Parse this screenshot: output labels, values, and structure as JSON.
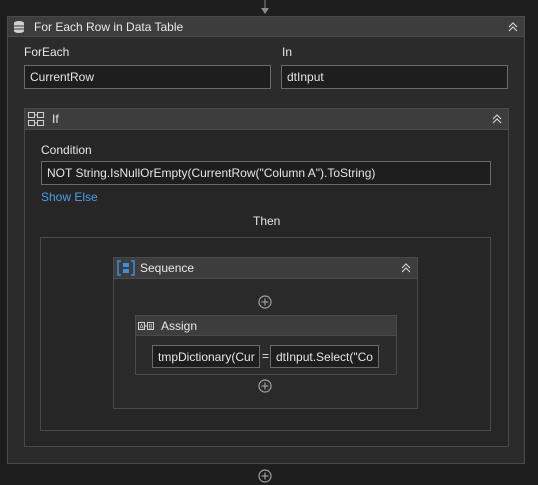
{
  "foreach": {
    "title": "For Each Row in Data Table",
    "foreach_label": "ForEach",
    "foreach_value": "CurrentRow",
    "in_label": "In",
    "in_value": "dtInput"
  },
  "if_block": {
    "title": "If",
    "condition_label": "Condition",
    "condition_value": "NOT String.IsNullOrEmpty(CurrentRow(\"Column A\").ToString)",
    "show_else": "Show Else",
    "then_label": "Then"
  },
  "sequence": {
    "title": "Sequence"
  },
  "assign": {
    "title": "Assign",
    "to_value": "tmpDictionary(Cur",
    "operator": "=",
    "value": "dtInput.Select(\"Co"
  },
  "icons": {
    "arrow": "arrow-down-icon",
    "table": "data-table-icon",
    "if": "if-icon",
    "sequence": "sequence-icon",
    "assign": "assign-icon",
    "add": "add-activity-icon",
    "collapse": "collapse-icon"
  },
  "colors": {
    "background": "#1e1e1e",
    "panel": "#2b2b2b",
    "header": "#3d3d3d",
    "link": "#4a9fe8",
    "sequence_icon": "#3b8fe0"
  }
}
